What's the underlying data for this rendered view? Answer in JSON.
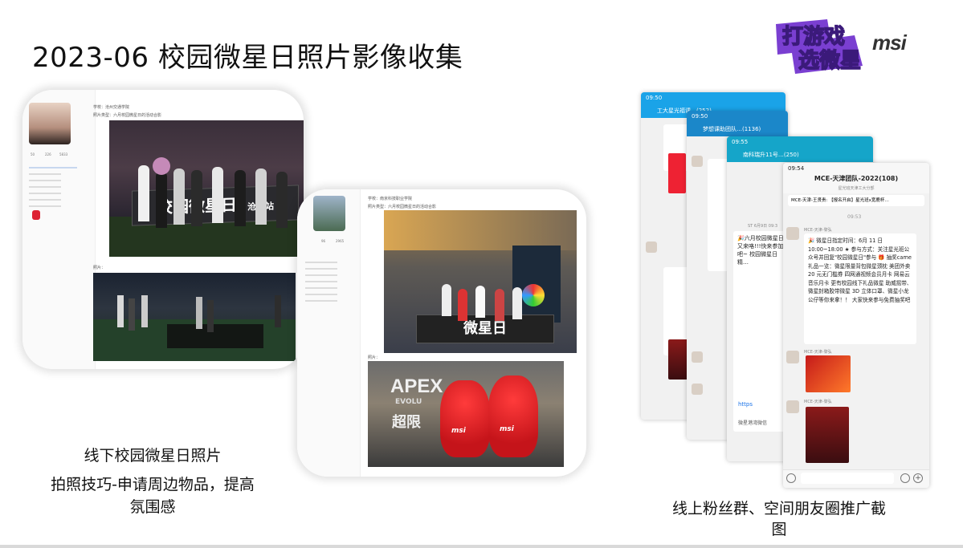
{
  "slide": {
    "title": "2023-06 校园微星日照片影像收集",
    "logo_game_line1": "打游戏",
    "logo_game_line2": "选微星",
    "logo_msi": "msi"
  },
  "left": {
    "caption_line1": "线下校园微星日照片",
    "caption_line2": "拍照技巧-申请周边物品，提高",
    "caption_line3": "氛围感",
    "card1": {
      "school_label": "学校：沧州交通学院",
      "photo_type_label": "照片类型：六月校园微星日的活动合影",
      "photos_label": "照片：",
      "banner_text": "校园微星日",
      "banner_station": "沧州站",
      "stats": [
        "50",
        "226",
        "5833"
      ]
    },
    "card2": {
      "school_label": "学校：南京科技职业学院",
      "photo_type_label": "照片类型：六月校园微星日的活动合影",
      "photos_label": "照片：",
      "stats": [
        "96",
        "2965"
      ],
      "banner_text": "微星日",
      "apex_text": "APEX",
      "evol_text": "EVOLU",
      "chao_text": "超限",
      "msi_tag1": "msi",
      "msi_tag2": "msi"
    }
  },
  "right": {
    "caption_line1": "线上粉丝群、空间朋友圈推广截",
    "caption_line2": "图",
    "phones": [
      {
        "time": "09:50",
        "header": "工大星光福课…(252)"
      },
      {
        "time": "09:50",
        "header": "梦想课助团队…(1136)"
      },
      {
        "time": "09:55",
        "header": "南科瑞升11号…(250)"
      },
      {
        "time": "09:54",
        "header": "MCE-天津团队-2022(108)"
      }
    ],
    "front_phone": {
      "subheader": "星光班天津工大分部",
      "pinned": "MCE-天津-王贤贵: 【报名开启】星光班x宽鹿杯…",
      "msg_time": "09:53",
      "sender": "MCE-天津-黎弘",
      "message": "🎉 微星日指定时间：6月 11 日 10:00~18:00 ★ 参与方式：关注星光班公众号并回复\"校园微星日\"参与 🎁 抽奖came礼品一览：微星限量背包微星颈枕 美团外卖 20 元无门槛券 四网通视频会员月卡 网易云音乐月卡 更有校园线下礼品微星 助威摇带、微星封箱胶带微星 3D 立体口罩、微星小龙公仔等你来拿！！ 大家快来参与免费抽奖吧",
      "sender2": "MCE-天津-黎弘",
      "sender3": "MCE-天津-黎弘"
    },
    "mid_phone": {
      "date_label": "ST 6月9日 09:3",
      "message": "🎉六月校园微星日又来咯!!!快来参加吧~ 校园微星日精…",
      "link": "https",
      "footer": "微星港湾微信"
    }
  },
  "colors": {
    "qq_blue": "#1aa3e8",
    "qq_blue_dark": "#1b87c9",
    "qq_teal": "#15a5c9",
    "logo_purple": "#7a3fd1",
    "logo_yellow": "#f5d623"
  }
}
